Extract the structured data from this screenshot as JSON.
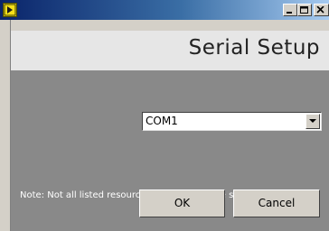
{
  "window": {
    "icon": "labview-vi-icon",
    "controls": [
      "minimize-icon",
      "maximize-icon",
      "close-icon"
    ]
  },
  "header": {
    "title": "Serial Setup"
  },
  "resource_select": {
    "selected": "COM1"
  },
  "note": "Note: Not all listed resources may actually be serial ports.",
  "buttons": {
    "ok_label": "OK",
    "cancel_label": "Cancel"
  },
  "colors": {
    "titlebar_start": "#0a246a",
    "titlebar_end": "#a6caf0",
    "panel_bg": "#898989",
    "header_bg": "#e6e6e6",
    "chrome": "#d4d0c8"
  }
}
